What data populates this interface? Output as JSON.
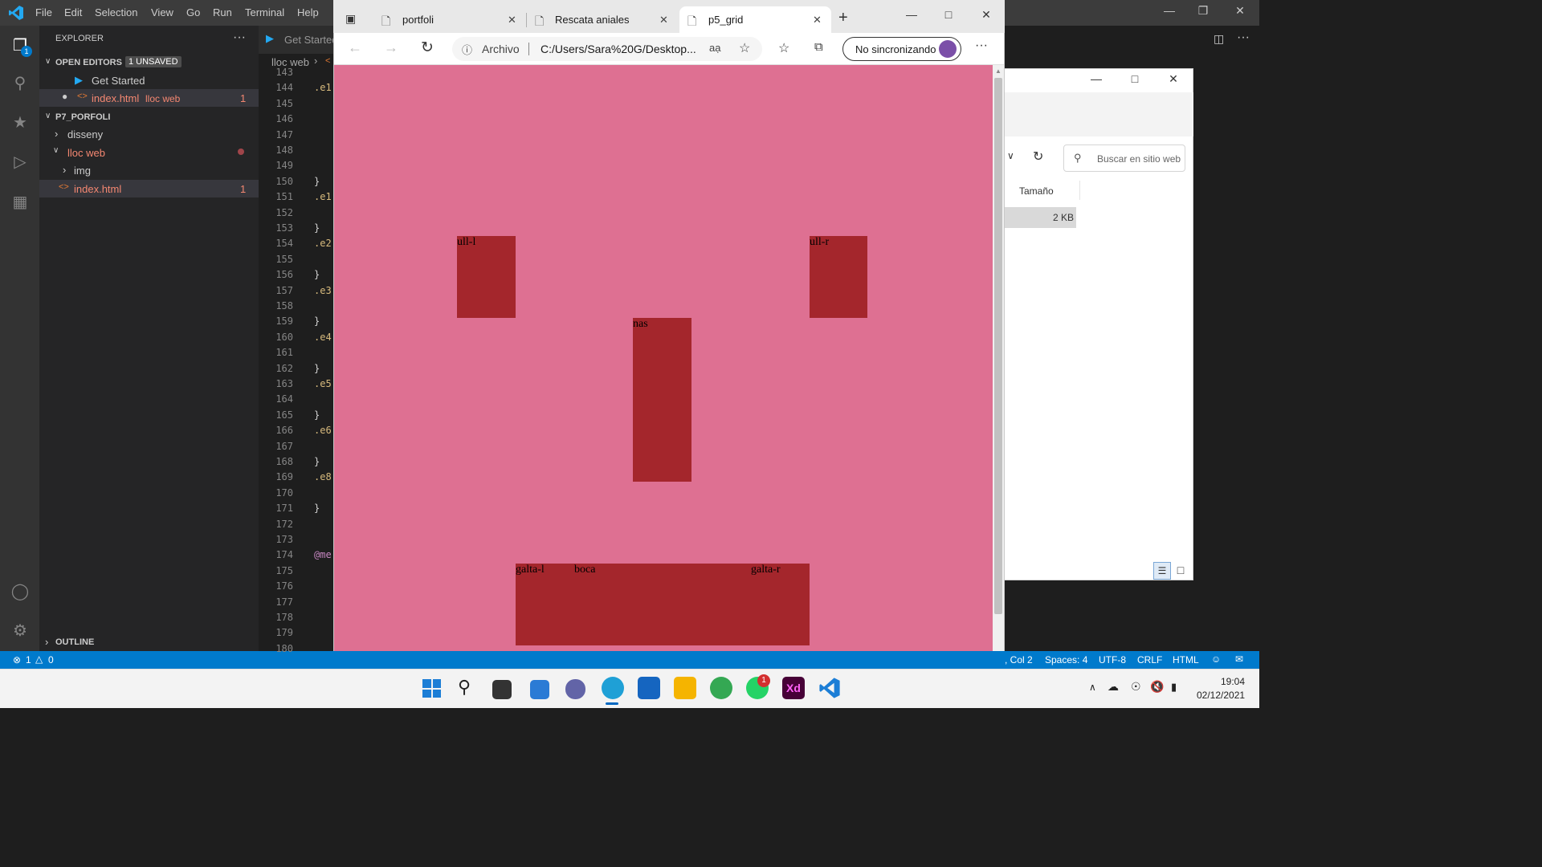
{
  "vscode": {
    "menu": [
      "File",
      "Edit",
      "Selection",
      "View",
      "Go",
      "Run",
      "Terminal",
      "Help"
    ],
    "explorer_title": "EXPLORER",
    "open_editors": "OPEN EDITORS",
    "unsaved_badge": "1 UNSAVED",
    "open_files": [
      {
        "name": "Get Started",
        "folder": "",
        "errors": ""
      },
      {
        "name": "index.html",
        "folder": "lloc web",
        "errors": "1"
      }
    ],
    "project": "P7_PORFOLI",
    "tree": [
      {
        "name": "disseny"
      },
      {
        "name": "lloc web"
      },
      {
        "name": "img"
      },
      {
        "name": "index.html",
        "errors": "1"
      }
    ],
    "outline": "OUTLINE",
    "tab_get_started": "Get Started",
    "breadcrumb": "lloc web",
    "line_numbers": [
      "143",
      "144",
      "145",
      "146",
      "147",
      "148",
      "149",
      "150",
      "151",
      "152",
      "153",
      "154",
      "155",
      "156",
      "157",
      "158",
      "159",
      "160",
      "161",
      "162",
      "163",
      "164",
      "165",
      "166",
      "167",
      "168",
      "169",
      "170",
      "171",
      "172",
      "173",
      "174",
      "175",
      "176",
      "177",
      "178",
      "179",
      "180"
    ],
    "code_fragments": {
      "144": ".e1",
      "150": "}",
      "151": ".e1",
      "153": "}",
      "154": ".e2",
      "156": "}",
      "157": ".e3",
      "159": "}",
      "160": ".e4",
      "162": "}",
      "163": ".e5",
      "165": "}",
      "166": ".e6",
      "168": "}",
      "169": ".e8",
      "171": "}",
      "174": "@me"
    },
    "activity_badge": "1",
    "status": {
      "errors": "1",
      "warnings": "0",
      "position": ", Col 2",
      "spaces": "Spaces: 4",
      "encoding": "UTF-8",
      "eol": "CRLF",
      "language": "HTML"
    }
  },
  "browser": {
    "tabs": [
      "portfoli",
      "Rescata aniales",
      "p5_grid"
    ],
    "url_label": "Archivo",
    "url": "C:/Users/Sara%20G/Desktop...",
    "sync_label": "No sincronizando",
    "page_bg": "#de7092",
    "box_color": "#a4262c",
    "boxes": {
      "ull_l": "ull-l",
      "ull_r": "ull-r",
      "nas": "nas",
      "galta_l": "galta-l",
      "boca": "boca",
      "galta_r": "galta-r"
    }
  },
  "file_explorer": {
    "search_placeholder": "Buscar en sitio web",
    "column": "Tamaño",
    "size": "2 KB"
  },
  "taskbar": {
    "time": "19:04",
    "date": "02/12/2021",
    "whatsapp_badge": "1"
  }
}
